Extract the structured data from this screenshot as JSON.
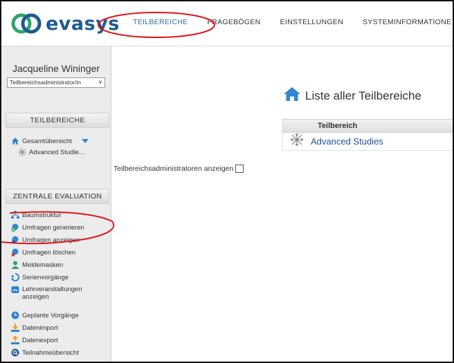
{
  "brand": {
    "name": "evasys"
  },
  "nav": {
    "items": [
      {
        "label": "TEILBEREICHE",
        "active": true
      },
      {
        "label": "FRAGEBÖGEN",
        "active": false
      },
      {
        "label": "EINSTELLUNGEN",
        "active": false
      },
      {
        "label": "SYSTEMINFORMATIONE",
        "active": false
      }
    ]
  },
  "user": {
    "name": "Jacqueline Wininger",
    "role_selected": "Teilbereichsadministrator/in"
  },
  "sidebar": {
    "teilbereiche": {
      "heading": "TEILBEREICHE",
      "overview": "Gesamtübersicht",
      "child": "Advanced Studie..."
    },
    "zentrale": {
      "heading": "ZENTRALE EVALUATION",
      "items": [
        {
          "label": "Baumstruktur",
          "icon": "tree-structure-icon"
        },
        {
          "label": "Umfragen generieren",
          "icon": "generate-survey-icon"
        },
        {
          "label": "Umfragen anzeigen",
          "icon": "view-surveys-icon"
        },
        {
          "label": "Umfragen löschen",
          "icon": "delete-surveys-icon"
        },
        {
          "label": "Meldemasken",
          "icon": "report-mask-icon"
        },
        {
          "label": "Serienvorgänge",
          "icon": "batch-process-icon"
        },
        {
          "label": "Lehrveranstaltungen anzeigen",
          "icon": "courses-icon"
        },
        {
          "label": "Geplante Vorgänge",
          "icon": "scheduled-tasks-icon"
        },
        {
          "label": "Datenimport",
          "icon": "data-import-icon"
        },
        {
          "label": "Datenexport",
          "icon": "data-export-icon"
        },
        {
          "label": "Teilnahmeübersicht",
          "icon": "participation-overview-icon"
        }
      ]
    }
  },
  "main": {
    "title": "Liste aller Teilbereiche",
    "table": {
      "column_header": "Teilbereich",
      "rows": [
        {
          "name": "Advanced Studies"
        }
      ]
    },
    "admin_toggle_label": "Teilbereichsadministratoren anzeigen",
    "admin_toggle_checked": false
  },
  "colors": {
    "brand": "#1f5b8f",
    "nav_active": "#2d6ca5",
    "link": "#1f4fa0",
    "annotation": "#e0131a"
  }
}
